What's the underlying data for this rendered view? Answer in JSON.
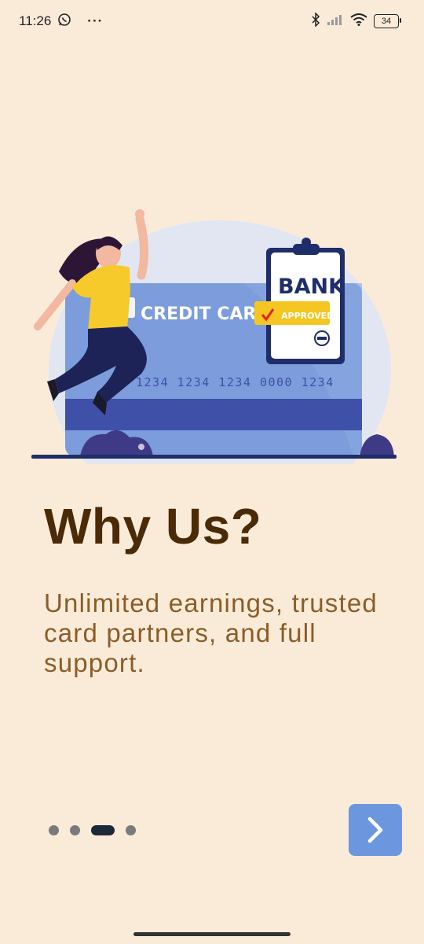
{
  "status_bar": {
    "time": "11:26",
    "overflow": "···",
    "battery": "34",
    "icons": [
      "whatsapp-icon",
      "bluetooth-icon",
      "signal-icon",
      "wifi-icon",
      "battery-icon"
    ]
  },
  "illustration": {
    "card_label": "CREDIT CARD",
    "card_number": "1234 1234 1234 0000 1234",
    "clipboard_title": "BANK",
    "stamp_label": "APPROVED"
  },
  "onboarding": {
    "title": "Why Us?",
    "subtitle": "Unlimited earnings, trusted card partners, and full support.",
    "page_count": 4,
    "active_page": 3
  },
  "colors": {
    "background": "#FAEBD9",
    "title": "#4A2A07",
    "subtitle": "#8B5D28",
    "button": "#6C97DF",
    "active_dot": "#1E2838",
    "inactive_dot": "#7A7A7A"
  },
  "next_button": {
    "icon": "chevron-right-icon"
  }
}
